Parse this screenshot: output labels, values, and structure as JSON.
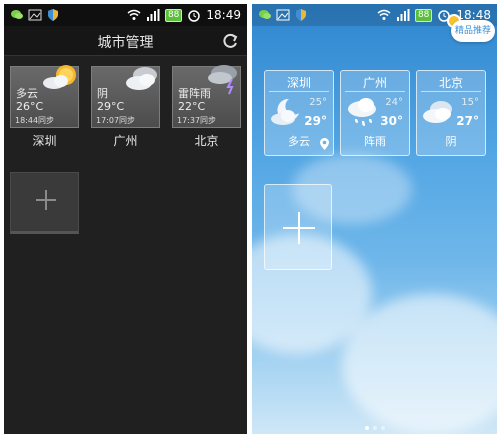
{
  "left_screen": {
    "status": {
      "time": "18:49",
      "battery": "88"
    },
    "title": "城市管理",
    "cities": [
      {
        "name": "深圳",
        "weather": "多云",
        "temp": "26°C",
        "sync": "18:44同步",
        "icon": "sun-cloud-icon"
      },
      {
        "name": "广州",
        "weather": "阴",
        "temp": "29°C",
        "sync": "17:07同步",
        "icon": "cloud-icon"
      },
      {
        "name": "北京",
        "weather": "雷阵雨",
        "temp": "22°C",
        "sync": "17:37同步",
        "icon": "thunderstorm-icon"
      }
    ]
  },
  "right_screen": {
    "status": {
      "time": "18:48",
      "battery": "88"
    },
    "promo": "精品推荐",
    "cities": [
      {
        "name": "深圳",
        "high": "25°",
        "low": "29°",
        "condition": "多云",
        "icon": "moon-cloud-icon"
      },
      {
        "name": "广州",
        "high": "24°",
        "low": "30°",
        "condition": "阵雨",
        "icon": "rain-cloud-icon"
      },
      {
        "name": "北京",
        "high": "15°",
        "low": "27°",
        "condition": "阴",
        "icon": "cloud-icon"
      }
    ]
  },
  "colors": {
    "left_bg": "#202020",
    "right_sky": "#53a6e4"
  }
}
